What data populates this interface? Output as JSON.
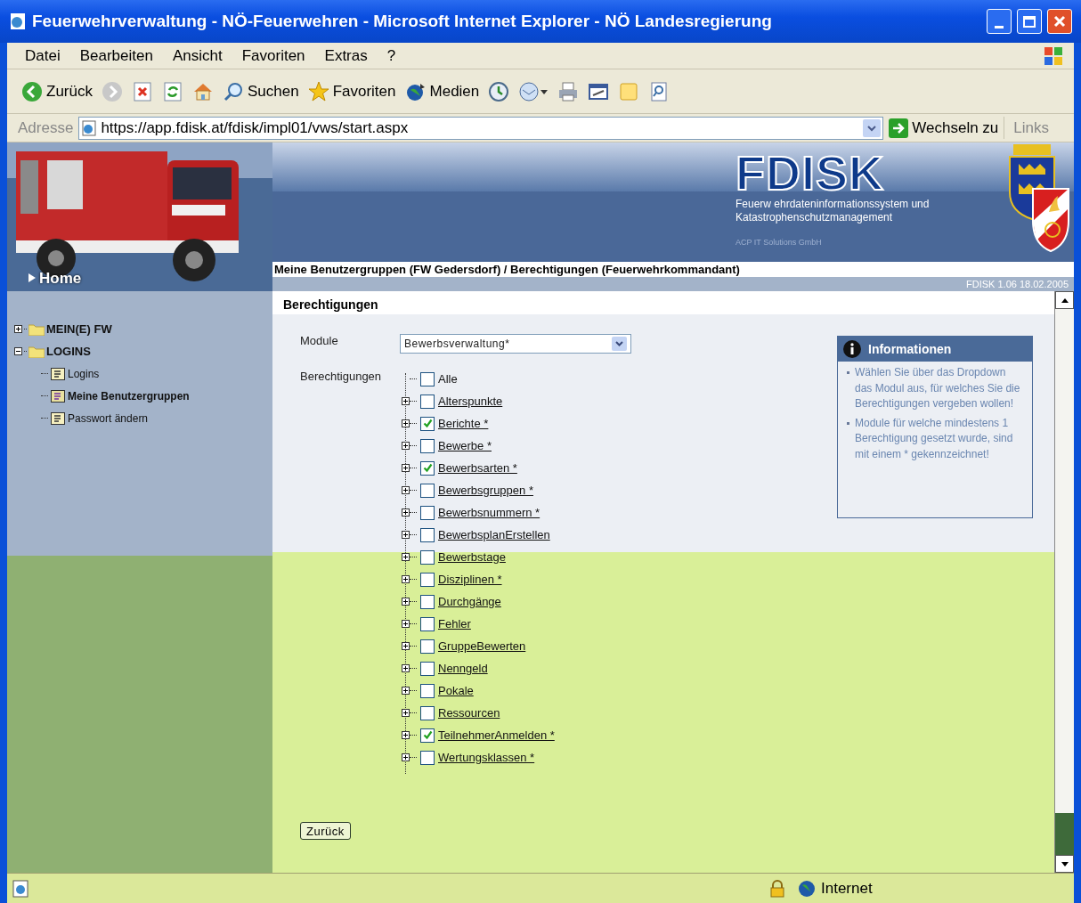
{
  "window": {
    "title": "Feuerwehrverwaltung - NÖ-Feuerwehren - Microsoft Internet Explorer - NÖ Landesregierung"
  },
  "menu": [
    "Datei",
    "Bearbeiten",
    "Ansicht",
    "Favoriten",
    "Extras",
    "?"
  ],
  "toolbar": [
    {
      "kind": "back",
      "label": "Zurück"
    },
    {
      "kind": "forward"
    },
    {
      "kind": "stop"
    },
    {
      "kind": "refresh"
    },
    {
      "kind": "home"
    },
    {
      "kind": "search",
      "label": "Suchen"
    },
    {
      "kind": "favorites",
      "label": "Favoriten"
    },
    {
      "kind": "media",
      "label": "Medien"
    },
    {
      "kind": "history"
    },
    {
      "kind": "mail"
    },
    {
      "kind": "print"
    },
    {
      "kind": "edit"
    },
    {
      "kind": "note"
    },
    {
      "kind": "research"
    }
  ],
  "address": {
    "label": "Adresse",
    "url": "https://app.fdisk.at/fdisk/impl01/vws/start.aspx",
    "go": "Wechseln zu",
    "links": "Links"
  },
  "banner": {
    "logo": "FDISK",
    "subtitle": [
      "Feuerw ehrdateninformationssystem und",
      "Katastrophenschutzmanagement"
    ],
    "company": "ACP IT Solutions GmbH",
    "home": "Home",
    "breadcrumb": "Meine Benutzergruppen (FW Gedersdorf) / Berechtigungen (Feuerwehrkommandant)",
    "version": "FDISK 1.06 18.02.2005"
  },
  "sidebar": {
    "items": [
      {
        "label": "MEIN(E) FW",
        "expanded": false
      },
      {
        "label": "LOGINS",
        "expanded": true,
        "children": [
          {
            "label": "Logins",
            "selected": false
          },
          {
            "label": "Meine Benutzergruppen",
            "selected": true
          },
          {
            "label": "Passwort ändern",
            "selected": false
          }
        ]
      }
    ]
  },
  "content": {
    "heading": "Berechtigungen",
    "module_label": "Module",
    "module_value": "Bewerbsverwaltung*",
    "permissions_label": "Berechtigungen",
    "permissions": [
      {
        "kind": "all",
        "label": "Alle",
        "checked": false
      },
      {
        "kind": "group",
        "label": "Alterspunkte",
        "checked": false
      },
      {
        "kind": "group",
        "label": "Berichte *",
        "checked": true
      },
      {
        "kind": "group",
        "label": "Bewerbe *",
        "checked": false
      },
      {
        "kind": "group",
        "label": "Bewerbsarten *",
        "checked": true
      },
      {
        "kind": "group",
        "label": "Bewerbsgruppen *",
        "checked": false
      },
      {
        "kind": "group",
        "label": "Bewerbsnummern *",
        "checked": false
      },
      {
        "kind": "group",
        "label": "BewerbsplanErstellen",
        "checked": false
      },
      {
        "kind": "group",
        "label": "Bewerbstage",
        "checked": false
      },
      {
        "kind": "group",
        "label": "Disziplinen *",
        "checked": false
      },
      {
        "kind": "group",
        "label": "Durchgänge",
        "checked": false
      },
      {
        "kind": "group",
        "label": "Fehler",
        "checked": false
      },
      {
        "kind": "group",
        "label": "GruppeBewerten",
        "checked": false
      },
      {
        "kind": "group",
        "label": "Nenngeld",
        "checked": false
      },
      {
        "kind": "group",
        "label": "Pokale",
        "checked": false
      },
      {
        "kind": "group",
        "label": "Ressourcen",
        "checked": false
      },
      {
        "kind": "group",
        "label": "TeilnehmerAnmelden *",
        "checked": true
      },
      {
        "kind": "group",
        "label": "Wertungsklassen *",
        "checked": false
      }
    ],
    "back_button": "Zurück",
    "info": {
      "title": "Informationen",
      "bullets": [
        "Wählen Sie über das Dropdown das Modul aus, für welches Sie die Berechtigungen vergeben wollen!",
        "Module für welche mindestens 1 Berechtigung gesetzt wurde, sind mit einem * gekennzeichnet!"
      ]
    }
  },
  "status_bar": {
    "zone": "Internet"
  }
}
